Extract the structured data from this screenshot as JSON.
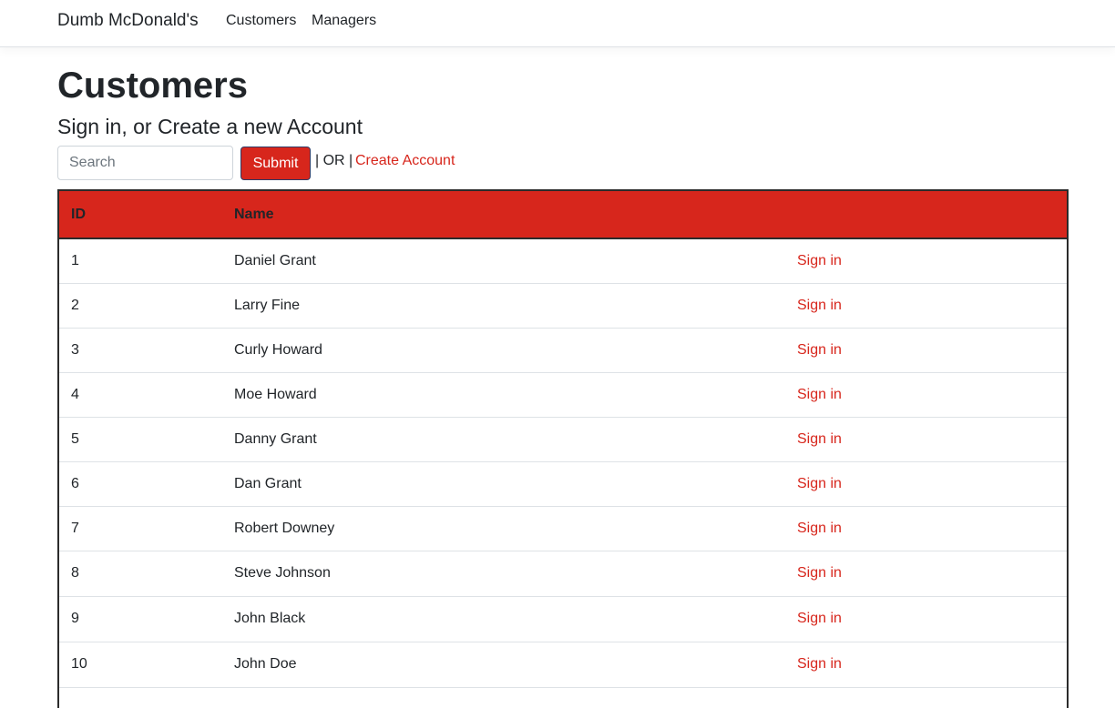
{
  "navbar": {
    "brand": "Dumb McDonald's",
    "links": [
      "Customers",
      "Managers"
    ]
  },
  "page": {
    "title": "Customers",
    "subtitle": "Sign in, or Create a new Account"
  },
  "search": {
    "placeholder": "Search",
    "value": "",
    "submit_label": "Submit",
    "or_text": "| OR |",
    "create_label": "Create Account"
  },
  "table": {
    "headers": [
      "ID",
      "Name",
      ""
    ],
    "action_label": "Sign in",
    "rows": [
      {
        "id": "1",
        "name": "Daniel Grant"
      },
      {
        "id": "2",
        "name": "Larry Fine"
      },
      {
        "id": "3",
        "name": "Curly Howard"
      },
      {
        "id": "4",
        "name": "Moe Howard"
      },
      {
        "id": "5",
        "name": "Danny Grant"
      },
      {
        "id": "6",
        "name": "Dan Grant"
      },
      {
        "id": "7",
        "name": "Robert Downey"
      },
      {
        "id": "8",
        "name": "Steve Johnson"
      },
      {
        "id": "9",
        "name": "John Black"
      },
      {
        "id": "10",
        "name": "John Doe"
      }
    ]
  },
  "colors": {
    "accent": "#d7261c",
    "table_border": "#2b2b2b"
  }
}
